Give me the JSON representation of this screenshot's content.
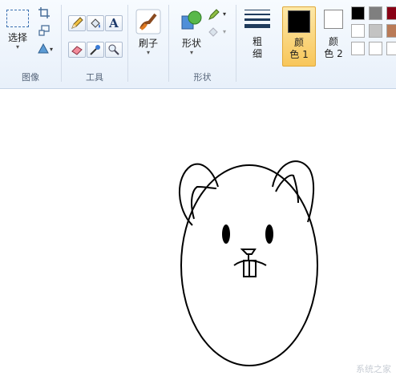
{
  "ribbon": {
    "image_group": {
      "label": "图像",
      "select_label": "选择"
    },
    "tools_group": {
      "label": "工具"
    },
    "brushes": {
      "label": "刷子"
    },
    "shapes_group": {
      "label": "形状",
      "shapes_label": "形状"
    },
    "size": {
      "label_line1": "粗",
      "label_line2": "细"
    },
    "color1": {
      "label_line1": "颜",
      "label_line2": "色 1",
      "color": "#000000"
    },
    "color2": {
      "label_line1": "颜",
      "label_line2": "色 2",
      "color": "#ffffff"
    },
    "palette": [
      [
        "#000000",
        "#7f7f7f",
        "#880015"
      ],
      [
        "#ffffff",
        "#c3c3c3",
        "#b97a57"
      ],
      [
        "#ffffff",
        "#ffffff",
        "#ffffff"
      ]
    ]
  },
  "canvas": {
    "drawing": "hamster-face"
  },
  "watermark": "系统之家"
}
